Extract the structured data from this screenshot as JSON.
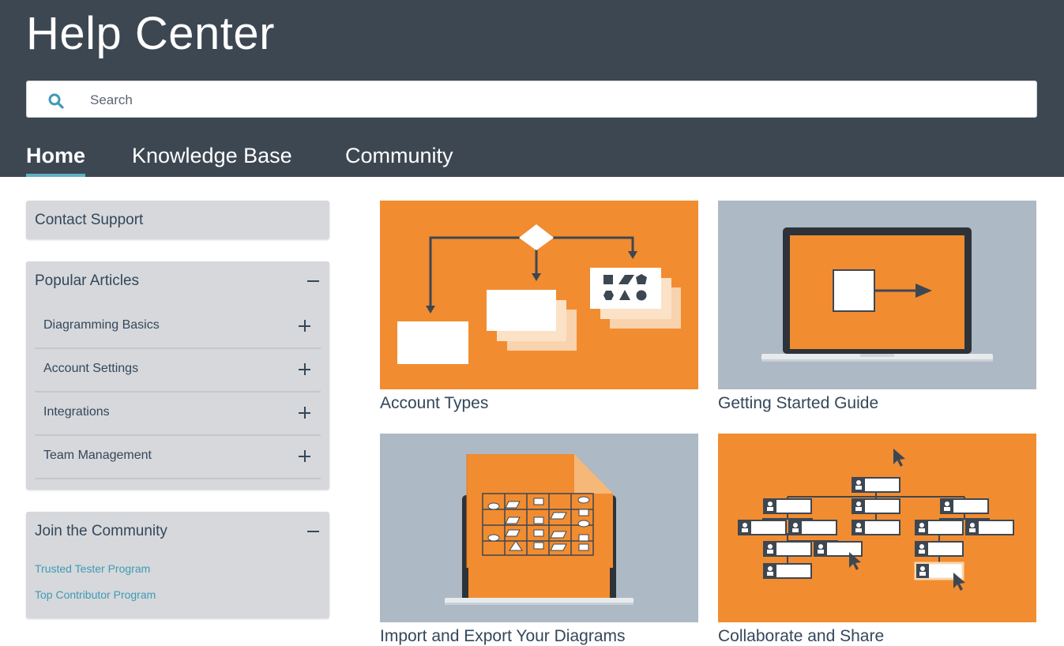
{
  "header": {
    "title": "Help Center",
    "search_placeholder": "Search"
  },
  "nav": {
    "tabs": [
      {
        "label": "Home",
        "active": true
      },
      {
        "label": "Knowledge Base",
        "active": false
      },
      {
        "label": "Community",
        "active": false
      }
    ]
  },
  "sidebar": {
    "contact_support": "Contact Support",
    "popular_articles": {
      "title": "Popular Articles",
      "items": [
        "Diagramming Basics",
        "Account Settings",
        "Integrations",
        "Team Management"
      ]
    },
    "community": {
      "title": "Join the Community",
      "links": [
        "Trusted Tester Program",
        "Top Contributor Program"
      ]
    }
  },
  "cards": [
    {
      "title": "Account Types",
      "icon": "flowchart-illustration"
    },
    {
      "title": "Getting Started Guide",
      "icon": "laptop-illustration"
    },
    {
      "title": "Import and Export Your Diagrams",
      "icon": "document-laptop-illustration"
    },
    {
      "title": "Collaborate and Share",
      "icon": "org-chart-illustration"
    }
  ],
  "colors": {
    "header_bg": "#3d4752",
    "accent_orange": "#f28c30",
    "card_grey_bg": "#adb9c5",
    "link_blue": "#3f9ab5",
    "tab_underline": "#5fb0c2"
  }
}
